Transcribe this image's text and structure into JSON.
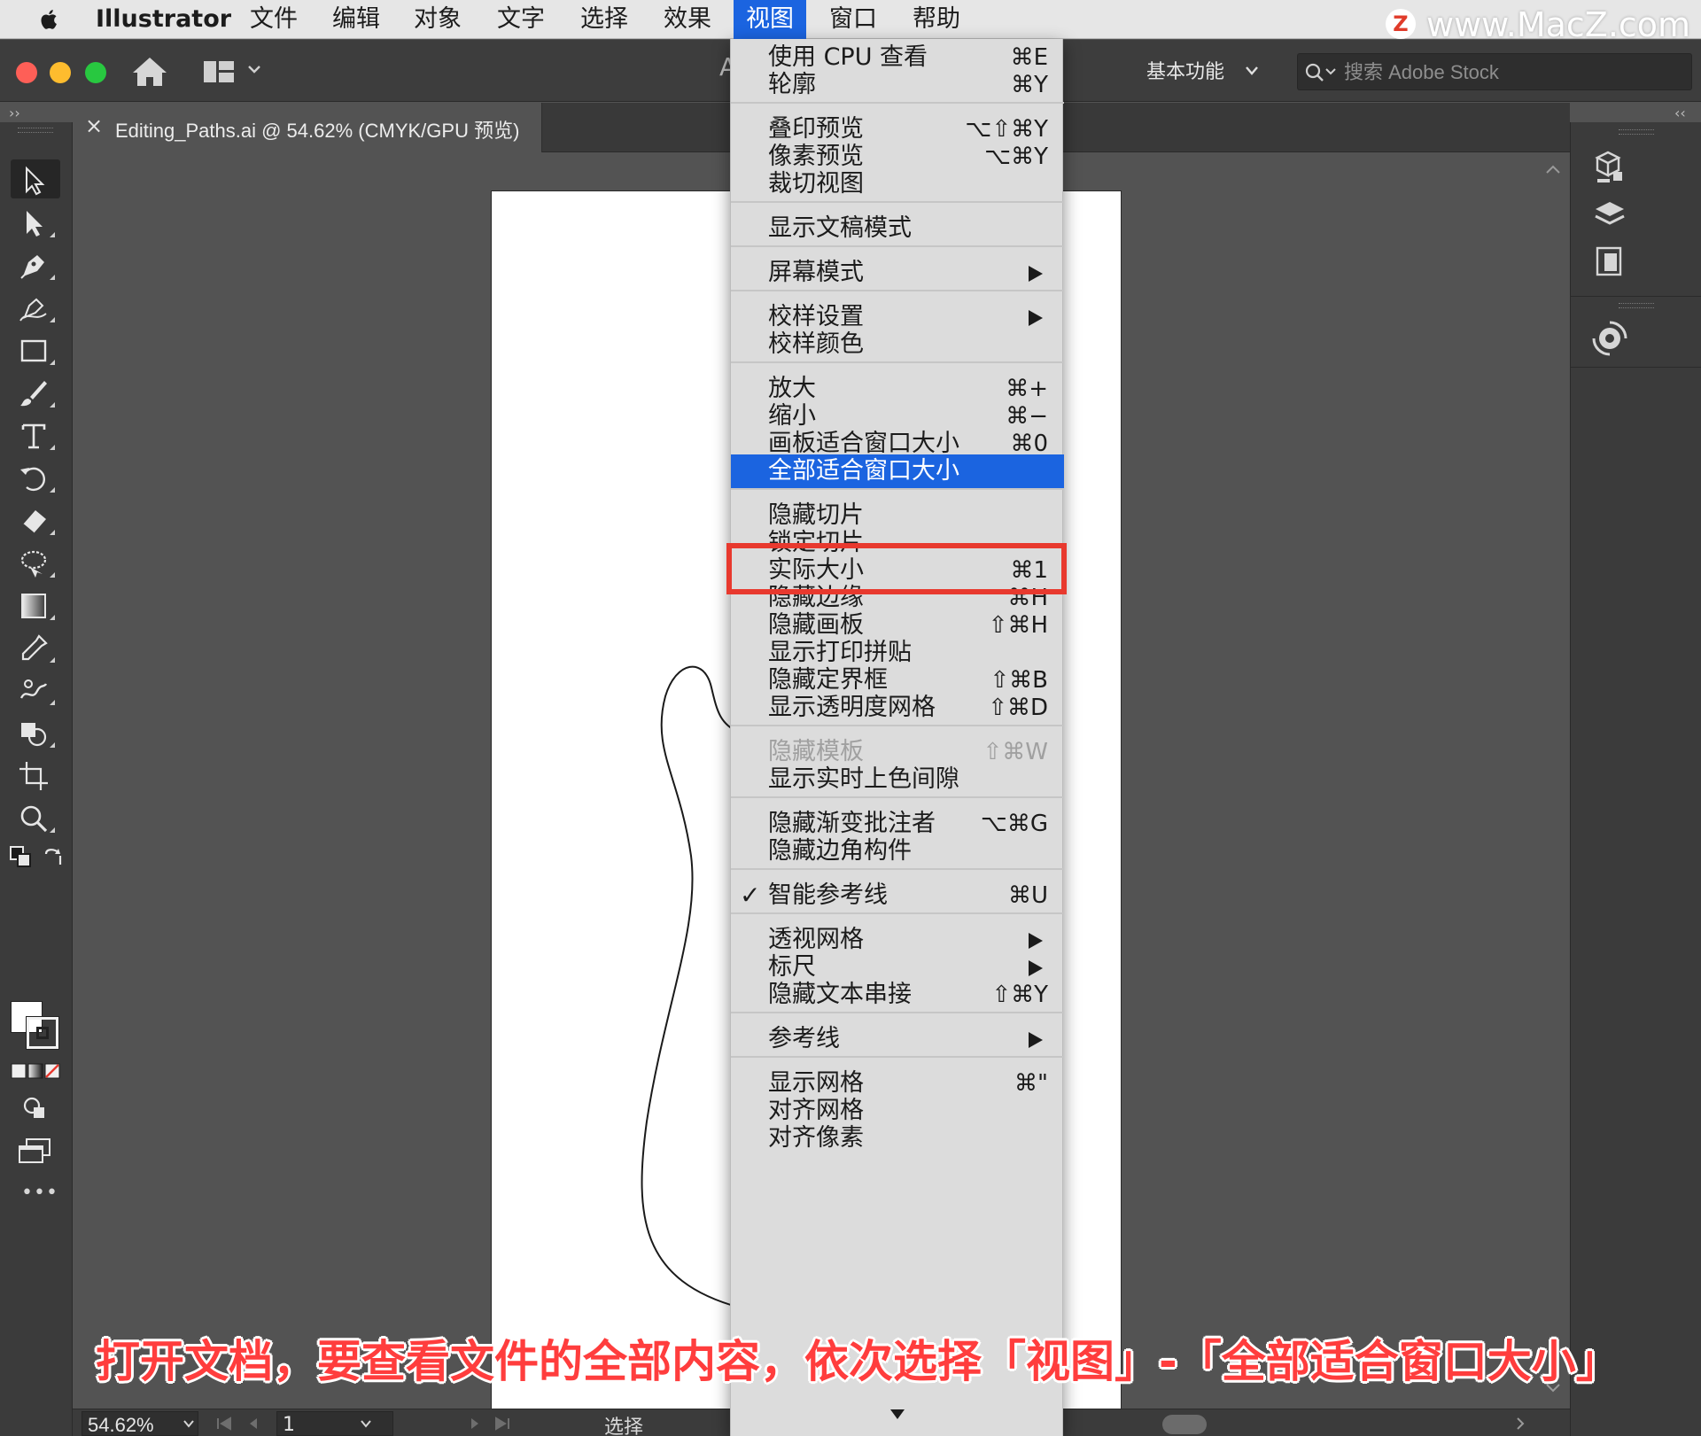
{
  "menubar": {
    "app_name": "Illustrator",
    "items": [
      "文件",
      "编辑",
      "对象",
      "文字",
      "选择",
      "效果",
      "视图",
      "窗口",
      "帮助"
    ],
    "active_item": "视图"
  },
  "watermark": {
    "badge": "Z",
    "text": "www.MacZ.com"
  },
  "toolbar": {
    "partial_text": "A",
    "workspace_label": "基本功能",
    "search_placeholder": "搜索 Adobe Stock"
  },
  "panel_collapse": {
    "left": "››",
    "right": "‹‹"
  },
  "document_tab": {
    "close": "×",
    "title": "Editing_Paths.ai @ 54.62% (CMYK/GPU 预览)"
  },
  "tools": [
    {
      "name": "selection-tool-icon",
      "selected": true
    },
    {
      "name": "direct-selection-tool-icon"
    },
    {
      "name": "pen-tool-icon"
    },
    {
      "name": "curvature-tool-icon"
    },
    {
      "name": "rectangle-tool-icon"
    },
    {
      "name": "paintbrush-tool-icon"
    },
    {
      "name": "type-tool-icon"
    },
    {
      "name": "rotate-tool-icon"
    },
    {
      "name": "eraser-tool-icon"
    },
    {
      "name": "lasso-tool-icon"
    },
    {
      "name": "gradient-tool-icon"
    },
    {
      "name": "eyedropper-tool-icon"
    },
    {
      "name": "puppet-warp-tool-icon"
    },
    {
      "name": "shape-builder-tool-icon"
    },
    {
      "name": "artboard-tool-icon"
    },
    {
      "name": "zoom-tool-icon"
    }
  ],
  "tools_more": "•••",
  "status": {
    "zoom": "54.62%",
    "page": "1",
    "current_tool": "选择"
  },
  "view_menu": {
    "items": [
      {
        "label": "使用 CPU 查看",
        "shortcut": "⌘E"
      },
      {
        "label": "轮廓",
        "shortcut": "⌘Y"
      },
      {
        "separator": true
      },
      {
        "label": "叠印预览",
        "shortcut": "⌥⇧⌘Y"
      },
      {
        "label": "像素预览",
        "shortcut": "⌥⌘Y"
      },
      {
        "label": "裁切视图",
        "shortcut": ""
      },
      {
        "separator": true
      },
      {
        "label": "显示文稿模式",
        "shortcut": ""
      },
      {
        "separator": true
      },
      {
        "label": "屏幕模式",
        "submenu": true
      },
      {
        "separator": true
      },
      {
        "label": "校样设置",
        "submenu": true
      },
      {
        "label": "校样颜色",
        "shortcut": ""
      },
      {
        "separator": true
      },
      {
        "label": "放大",
        "shortcut": "⌘+"
      },
      {
        "label": "缩小",
        "shortcut": "⌘−"
      },
      {
        "label": "画板适合窗口大小",
        "shortcut": "⌘0"
      },
      {
        "label": "全部适合窗口大小",
        "shortcut": "",
        "highlight": true
      },
      {
        "separator": true
      },
      {
        "label": "隐藏切片",
        "shortcut": ""
      },
      {
        "label": "锁定切片",
        "shortcut": ""
      },
      {
        "label": "实际大小",
        "shortcut": "⌘1"
      },
      {
        "label": "隐藏边缘",
        "shortcut": "⌘H"
      },
      {
        "label": "隐藏画板",
        "shortcut": "⇧⌘H"
      },
      {
        "label": "显示打印拼贴",
        "shortcut": ""
      },
      {
        "label": "隐藏定界框",
        "shortcut": "⇧⌘B"
      },
      {
        "label": "显示透明度网格",
        "shortcut": "⇧⌘D"
      },
      {
        "separator": true
      },
      {
        "label": "隐藏模板",
        "shortcut": "⇧⌘W",
        "disabled": true
      },
      {
        "label": "显示实时上色间隙",
        "shortcut": ""
      },
      {
        "separator": true
      },
      {
        "label": "隐藏渐变批注者",
        "shortcut": "⌥⌘G"
      },
      {
        "label": "隐藏边角构件",
        "shortcut": ""
      },
      {
        "separator": true
      },
      {
        "label": "智能参考线",
        "shortcut": "⌘U",
        "checked": true
      },
      {
        "separator": true
      },
      {
        "label": "透视网格",
        "submenu": true
      },
      {
        "label": "标尺",
        "submenu": true
      },
      {
        "label": "隐藏文本串接",
        "shortcut": "⇧⌘Y"
      },
      {
        "separator": true
      },
      {
        "label": "参考线",
        "submenu": true
      },
      {
        "separator": true
      },
      {
        "label": "显示网格",
        "shortcut": "⌘\""
      },
      {
        "label": "对齐网格",
        "shortcut": ""
      },
      {
        "label": "对齐像素",
        "shortcut": ""
      }
    ],
    "check_mark": "✓"
  },
  "caption": "打开文档，要查看文件的全部内容，依次选择「视图」-「全部适合窗口大小」",
  "colors": {
    "menu_highlight": "#1b64e0",
    "annotation_red": "#e8392e",
    "close_light": "#fe5f57",
    "minimize_light": "#febc2e",
    "zoom_light": "#28c840"
  }
}
